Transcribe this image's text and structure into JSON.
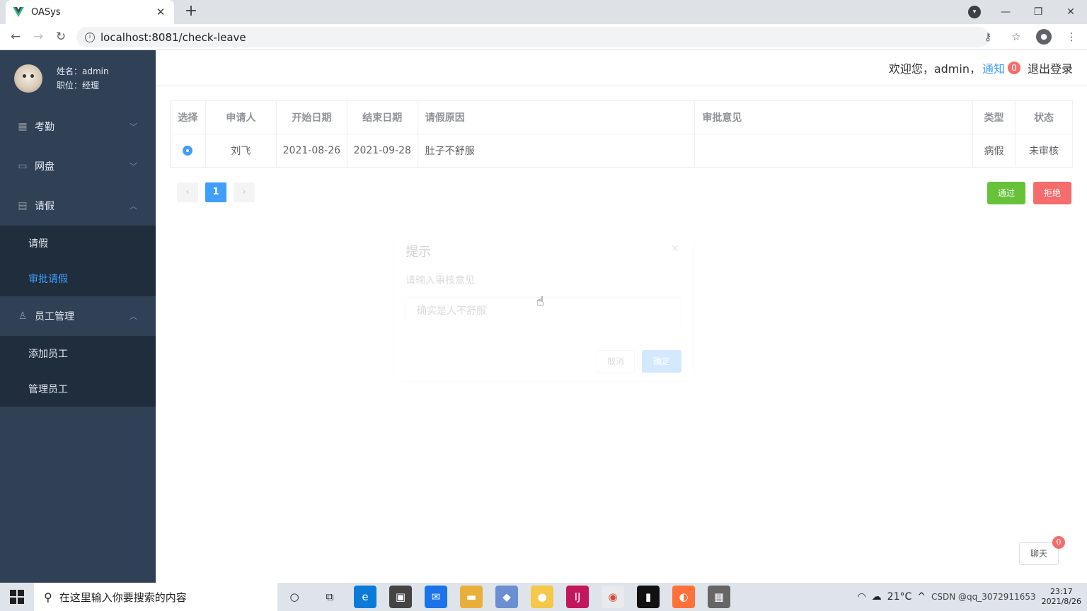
{
  "browser": {
    "tab_title": "OASys",
    "url": "localhost:8081/check-leave",
    "icons": [
      "vue-logo-icon",
      "close-tab-icon",
      "new-tab-icon",
      "profile-dropdown-icon",
      "minimize-icon",
      "restore-icon",
      "close-window-icon",
      "back-icon",
      "forward-icon",
      "reload-icon",
      "site-info-icon",
      "key-icon",
      "star-icon",
      "account-icon",
      "more-icon"
    ]
  },
  "sidebar": {
    "user_name": "姓名：admin",
    "user_role": "职位：经理",
    "menus": [
      {
        "label": "考勤",
        "icon": "grid-icon",
        "expanded": false
      },
      {
        "label": "网盘",
        "icon": "folder-icon",
        "expanded": false
      },
      {
        "label": "请假",
        "icon": "document-icon",
        "expanded": true,
        "children": [
          "请假",
          "审批请假"
        ]
      },
      {
        "label": "员工管理",
        "icon": "user-icon",
        "expanded": true,
        "children": [
          "添加员工",
          "管理员工"
        ]
      }
    ],
    "active_item": "审批请假",
    "colors": {
      "bg": "#304156",
      "active": "#409eff"
    }
  },
  "header": {
    "welcome": "欢迎您，admin，",
    "notice_label": "通知",
    "notice_count": "0",
    "logout": "退出登录"
  },
  "table": {
    "columns": [
      "选择",
      "申请人",
      "开始日期",
      "结束日期",
      "请假原因",
      "审批意见",
      "类型",
      "状态"
    ],
    "rows": [
      {
        "selected": true,
        "applicant": "刘飞",
        "start": "2021-08-26",
        "end": "2021-09-28",
        "reason": "肚子不舒服",
        "opinion": "",
        "type": "病假",
        "status": "未审核"
      }
    ]
  },
  "pagination": {
    "prev": "‹",
    "current": "1",
    "next": "›"
  },
  "actions": {
    "pass": "通过",
    "reject": "拒绝",
    "colors": {
      "pass": "#67c23a",
      "reject": "#f56c6c"
    }
  },
  "dialog": {
    "title": "提示",
    "message": "请输入审核意见",
    "input_value": "确实是人不舒服",
    "cancel": "取消",
    "confirm": "确定"
  },
  "chat": {
    "label": "聊天",
    "count": "0"
  },
  "taskbar": {
    "search_placeholder": "在这里输入你要搜索的内容",
    "weather": "21°C",
    "time": "23:17",
    "date": "2021/8/26",
    "watermark": "CSDN @qq_3072911653"
  }
}
